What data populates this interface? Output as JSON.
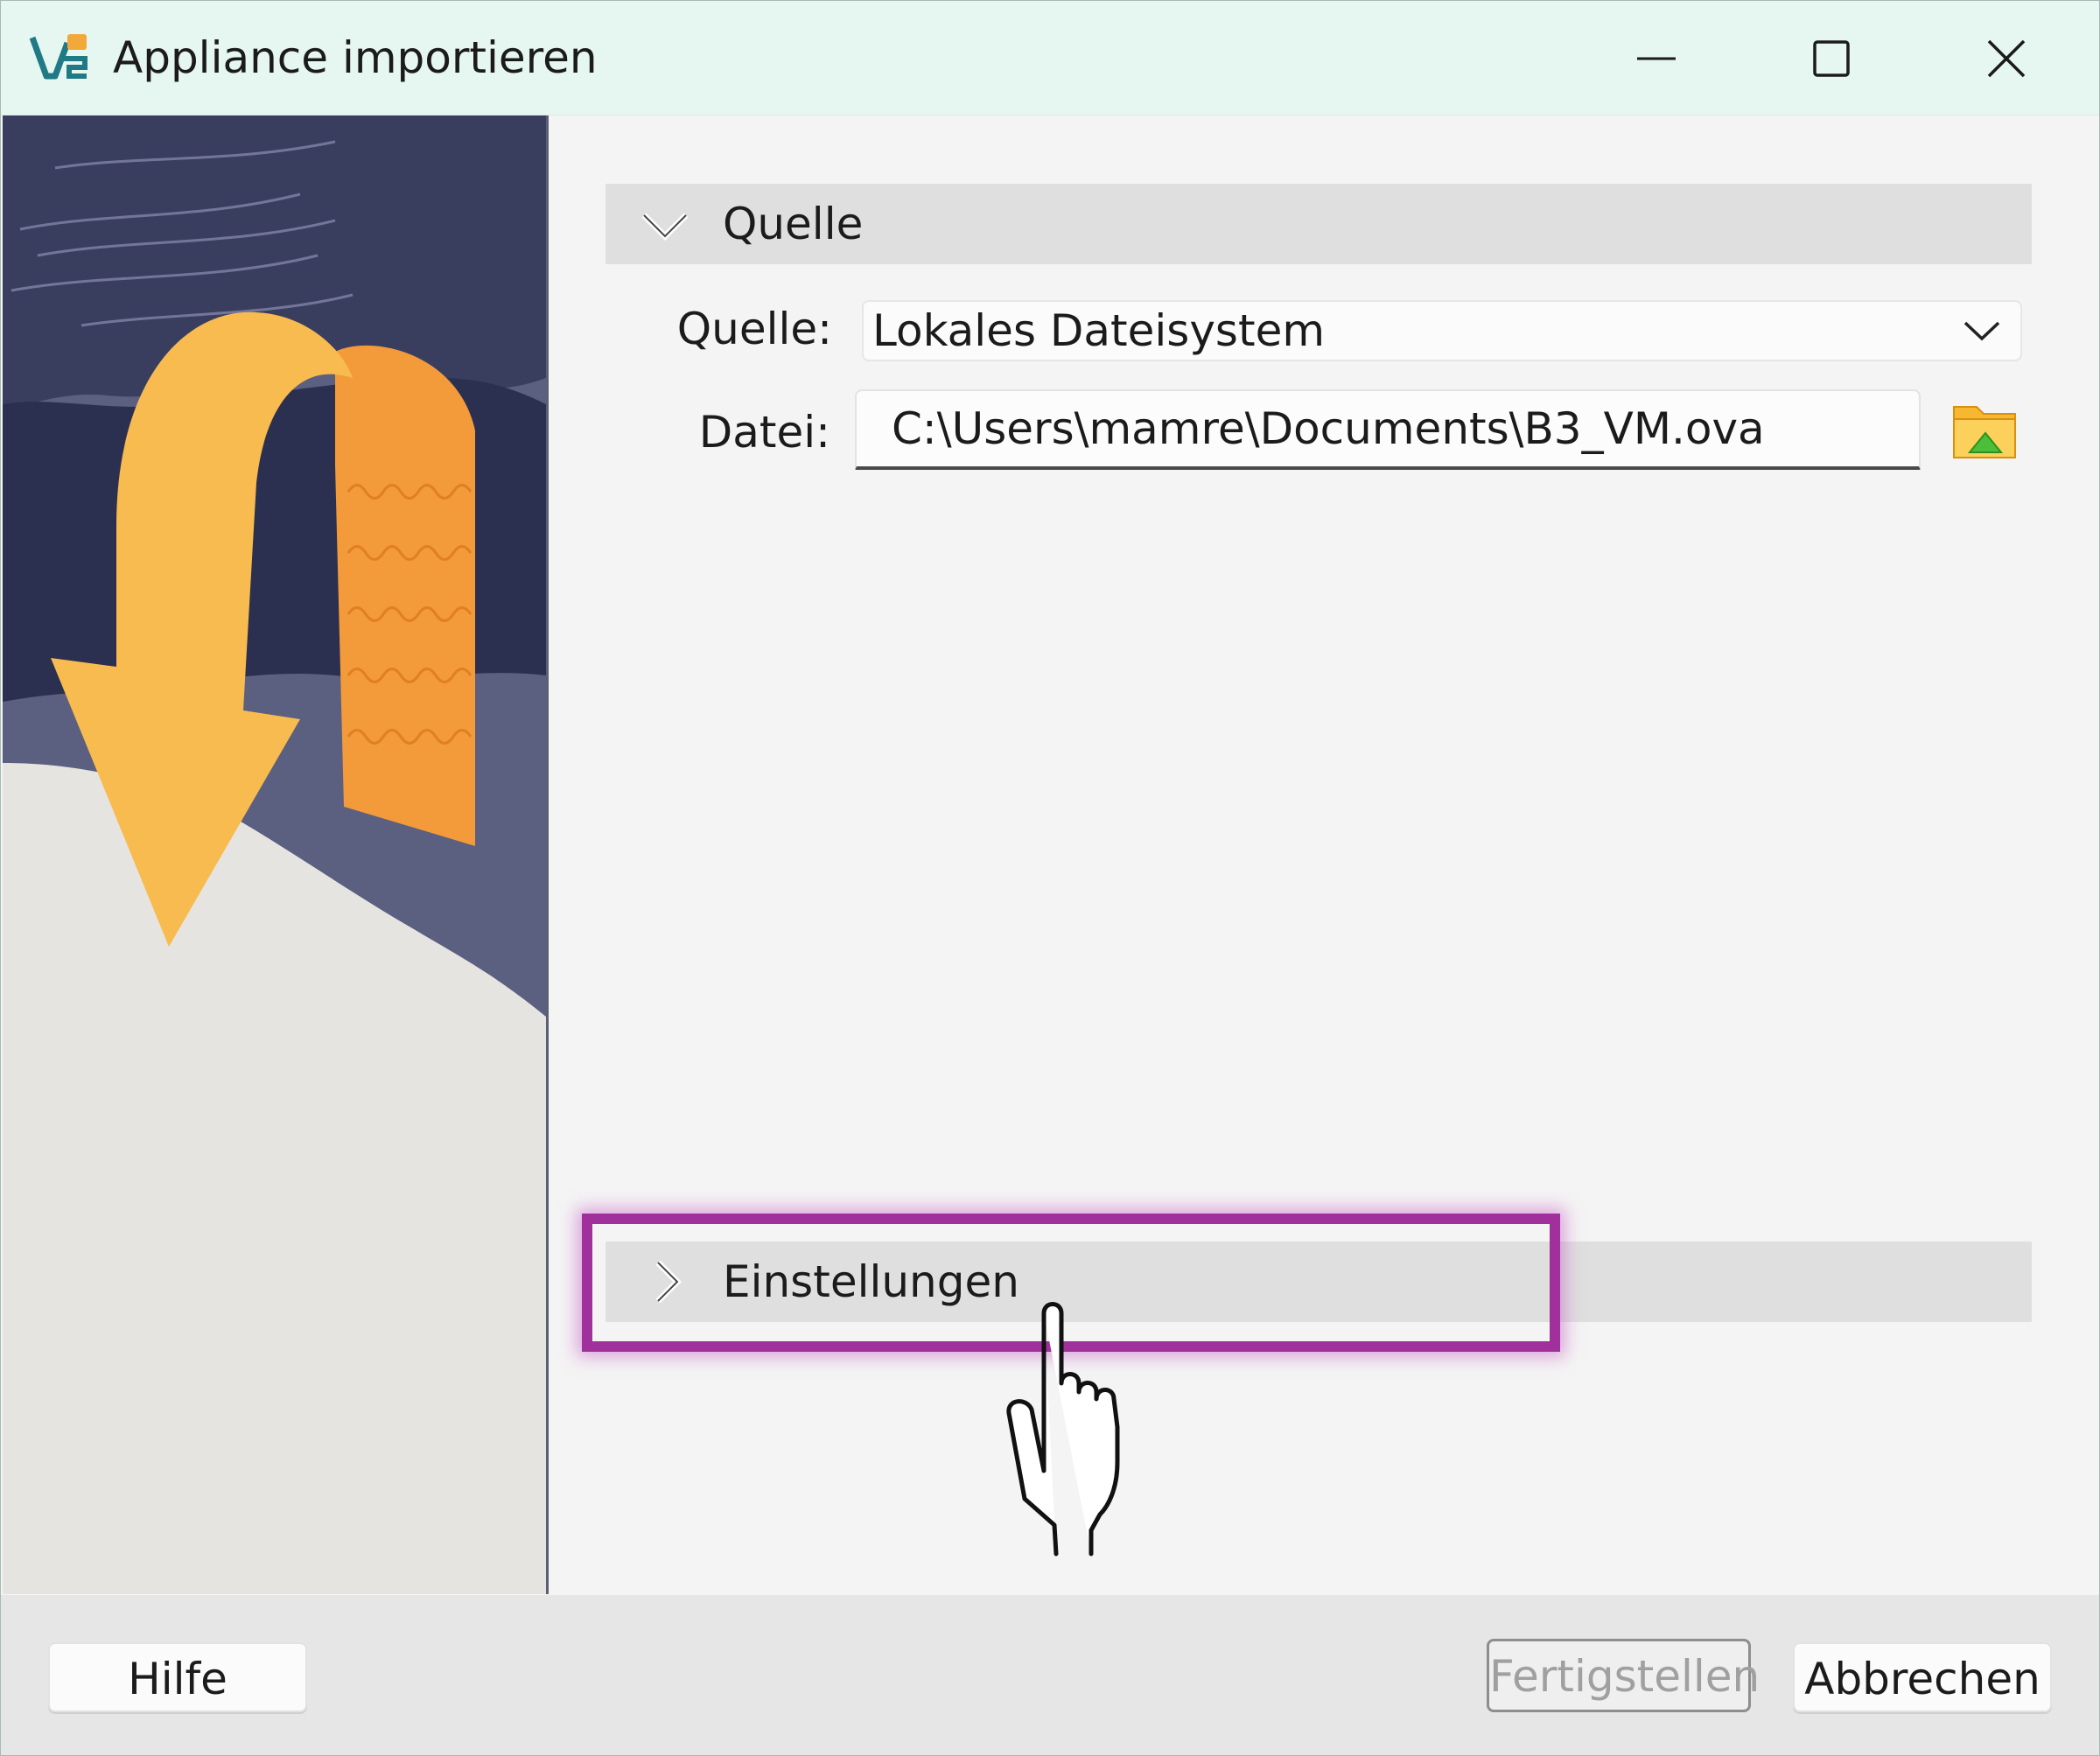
{
  "window": {
    "title": "Appliance importieren"
  },
  "source_section": {
    "header": "Quelle",
    "source_label": "Quelle:",
    "source_value": "Lokales Dateisystem",
    "file_label": "Datei:",
    "file_value": "C:\\Users\\mamre\\Documents\\B3_VM.ova"
  },
  "settings_section": {
    "header": "Einstellungen"
  },
  "footer": {
    "help": "Hilfe",
    "finish": "Fertigstellen",
    "cancel": "Abbrechen"
  },
  "colors": {
    "highlight": "#a0309b",
    "titlebar": "#e6f6f1",
    "banner_arrow": "#f8bb4f",
    "banner_dark": "#2f3350"
  }
}
